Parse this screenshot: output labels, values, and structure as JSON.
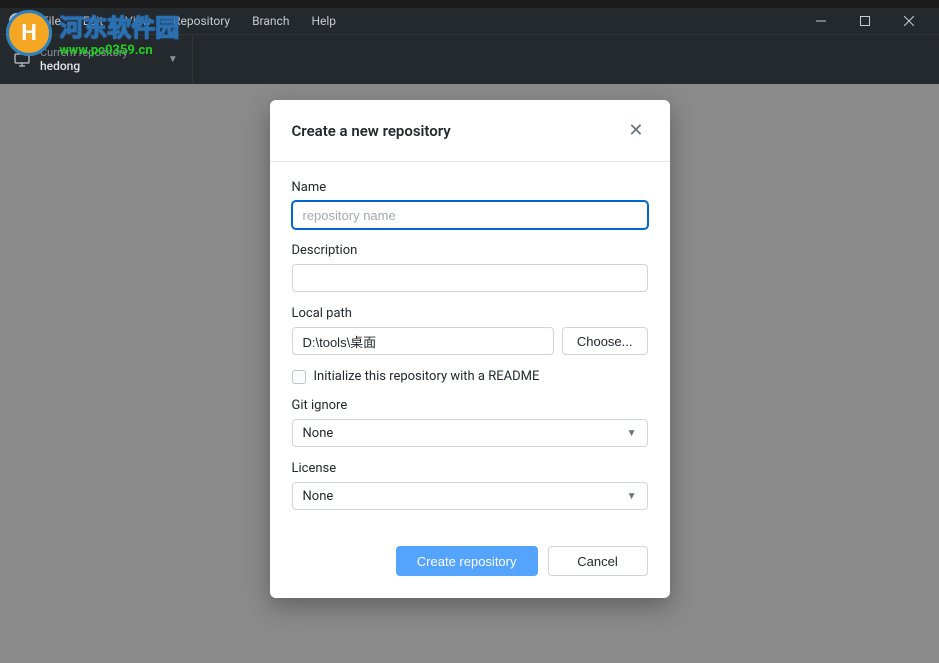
{
  "watermark": {
    "cn": "河东软件园",
    "url": "www.pc0359.cn"
  },
  "menu": {
    "items": [
      "File",
      "Edit",
      "View",
      "Repository",
      "Branch",
      "Help"
    ]
  },
  "toolbar": {
    "current_repo_label": "Current repository",
    "current_repo_name": "hedong"
  },
  "modal": {
    "title": "Create a new repository",
    "name_label": "Name",
    "name_placeholder": "repository name",
    "name_value": "",
    "description_label": "Description",
    "description_value": "",
    "local_path_label": "Local path",
    "local_path_value": "D:\\tools\\桌面",
    "choose_label": "Choose...",
    "init_readme_label": "Initialize this repository with a README",
    "init_readme_checked": false,
    "gitignore_label": "Git ignore",
    "gitignore_value": "None",
    "license_label": "License",
    "license_value": "None",
    "create_button": "Create repository",
    "cancel_button": "Cancel"
  }
}
